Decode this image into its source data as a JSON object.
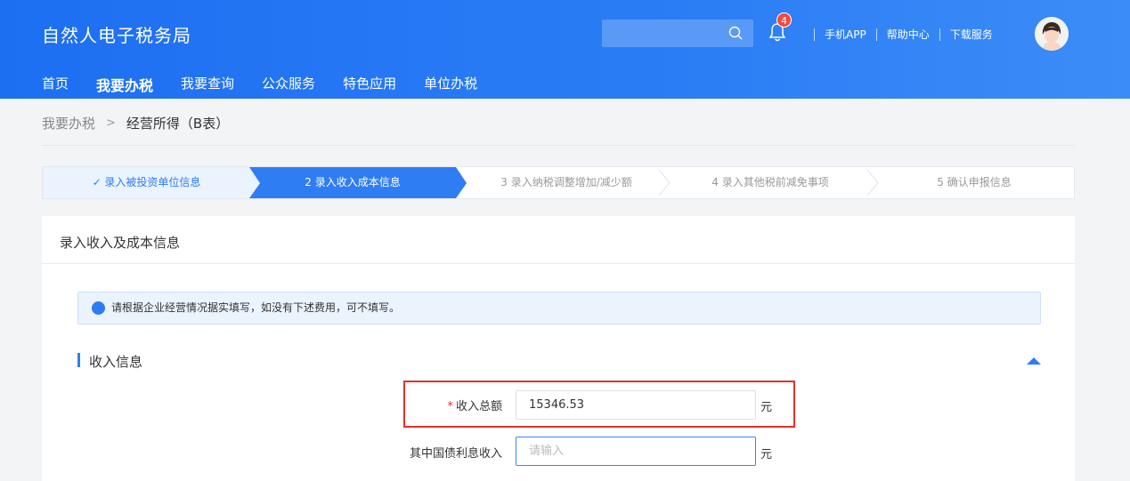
{
  "header": {
    "app_title": "自然人电子税务局",
    "search_placeholder": "",
    "notification_count": "4",
    "links": [
      "手机APP",
      "帮助中心",
      "下载服务"
    ]
  },
  "nav": {
    "items": [
      {
        "label": "首页",
        "active": false
      },
      {
        "label": "我要办税",
        "active": true
      },
      {
        "label": "我要查询",
        "active": false
      },
      {
        "label": "公众服务",
        "active": false
      },
      {
        "label": "特色应用",
        "active": false
      },
      {
        "label": "单位办税",
        "active": false
      }
    ]
  },
  "breadcrumb": {
    "parent": "我要办税",
    "current": "经营所得（B表）"
  },
  "steps": [
    {
      "label": "✓ 录入被投资单位信息",
      "state": "done"
    },
    {
      "label": "2  录入收入成本信息",
      "state": "active"
    },
    {
      "label": "3  录入纳税调整增加/减少额",
      "state": "pending"
    },
    {
      "label": "4  录入其他税前减免事项",
      "state": "pending"
    },
    {
      "label": "5  确认申报信息",
      "state": "pending"
    }
  ],
  "card": {
    "title": "录入收入及成本信息",
    "notice": "请根据企业经营情况据实填写，如没有下述费用，可不填写。",
    "section_title": "收入信息"
  },
  "form": {
    "total_income": {
      "label": "收入总额",
      "required": true,
      "value": "15346.53",
      "unit": "元"
    },
    "bond_interest": {
      "label": "其中国债利息收入",
      "required": false,
      "value": "",
      "placeholder": "请输入",
      "unit": "元"
    }
  },
  "colors": {
    "primary": "#2f7df3",
    "header": "#1d6ff2",
    "highlight": "#e0302a"
  }
}
